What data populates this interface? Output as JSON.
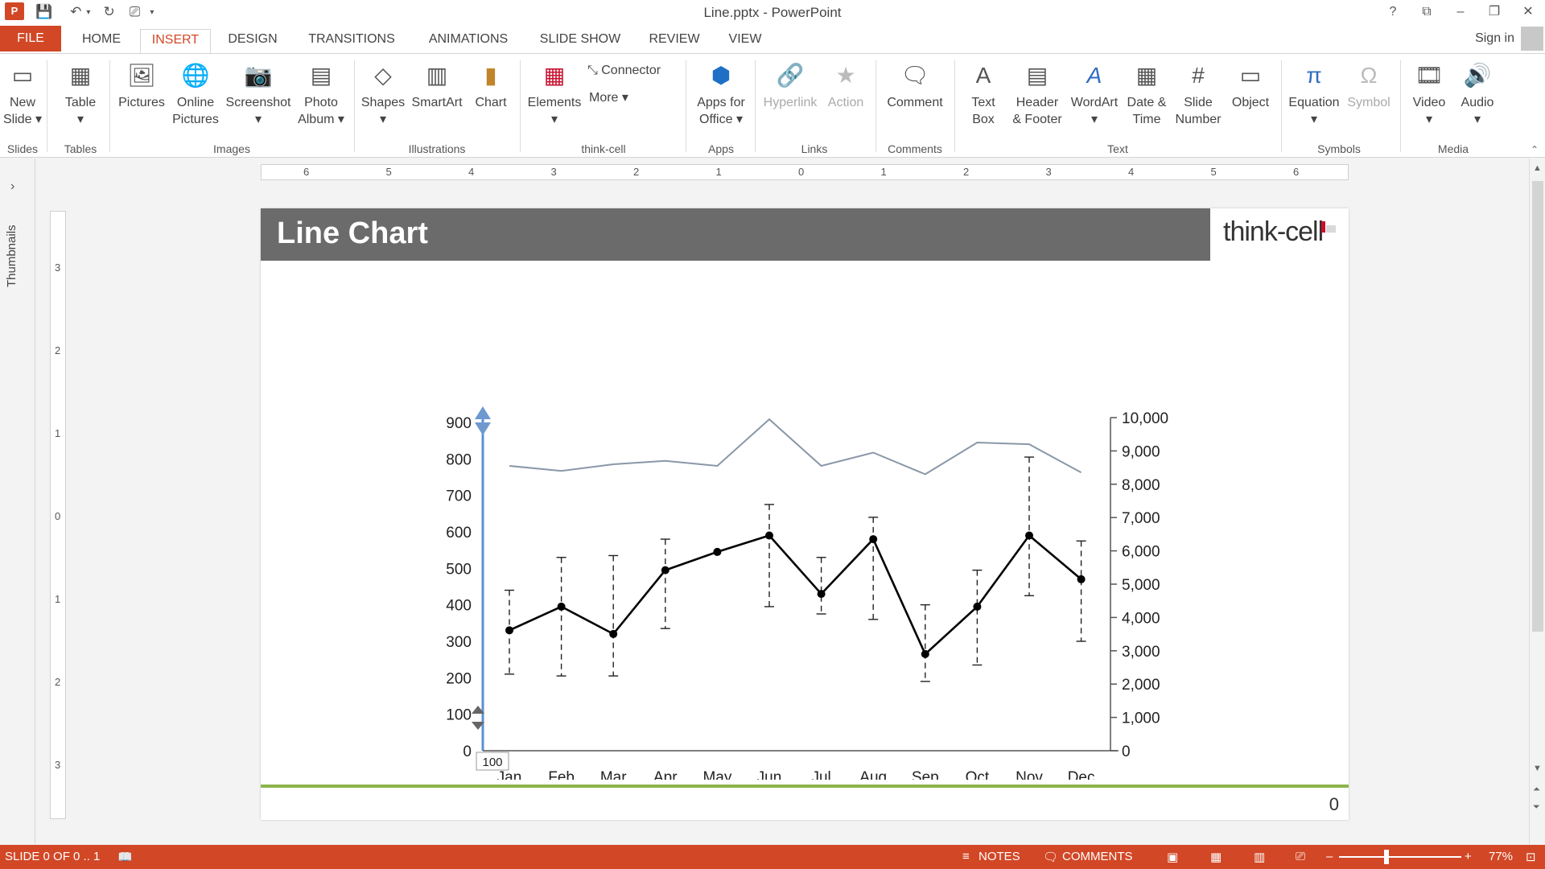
{
  "window": {
    "title": "Line.pptx - PowerPoint"
  },
  "qat": {
    "save_icon": "save-icon",
    "undo_icon": "undo-icon",
    "redo_icon": "redo-icon",
    "present_icon": "present-icon",
    "customize_icon": "customize-icon"
  },
  "tabs": {
    "file": "FILE",
    "home": "HOME",
    "insert": "INSERT",
    "design": "DESIGN",
    "transitions": "TRANSITIONS",
    "animations": "ANIMATIONS",
    "slideshow": "SLIDE SHOW",
    "review": "REVIEW",
    "view": "VIEW",
    "signin": "Sign in"
  },
  "ribbon": {
    "new_slide": [
      "New",
      "Slide ▾"
    ],
    "table": [
      "Table",
      "▾"
    ],
    "pictures": [
      "Pictures"
    ],
    "online_pictures": [
      "Online",
      "Pictures"
    ],
    "screenshot": [
      "Screenshot",
      "▾"
    ],
    "photo_album": [
      "Photo",
      "Album ▾"
    ],
    "shapes": [
      "Shapes",
      "▾"
    ],
    "smartart": [
      "SmartArt"
    ],
    "chart": [
      "Chart"
    ],
    "elements": [
      "Elements",
      "▾"
    ],
    "connector": "Connector",
    "more": "More ▾",
    "apps_office": [
      "Apps for",
      "Office ▾"
    ],
    "hyperlink": [
      "Hyperlink"
    ],
    "action": [
      "Action"
    ],
    "comment": [
      "Comment"
    ],
    "text_box": [
      "Text",
      "Box"
    ],
    "header_footer": [
      "Header",
      "& Footer"
    ],
    "wordart": [
      "WordArt",
      "▾"
    ],
    "date_time": [
      "Date &",
      "Time"
    ],
    "slide_number": [
      "Slide",
      "Number"
    ],
    "object": [
      "Object"
    ],
    "equation": [
      "Equation",
      "▾"
    ],
    "symbol": [
      "Symbol"
    ],
    "video": [
      "Video",
      "▾"
    ],
    "audio": [
      "Audio",
      "▾"
    ],
    "groups": {
      "slides": "Slides",
      "tables": "Tables",
      "images": "Images",
      "illustrations": "Illustrations",
      "thinkcell": "think-cell",
      "apps": "Apps",
      "links": "Links",
      "comments": "Comments",
      "text": "Text",
      "symbols": "Symbols",
      "media": "Media"
    }
  },
  "rail": {
    "thumbnails": "Thumbnails"
  },
  "rulers": {
    "horizontal": [
      "6",
      "5",
      "4",
      "3",
      "2",
      "1",
      "0",
      "1",
      "2",
      "3",
      "4",
      "5",
      "6"
    ],
    "vertical": [
      "3",
      "2",
      "1",
      "0",
      "1",
      "2",
      "3"
    ]
  },
  "slide": {
    "title": "Line Chart",
    "brand": "think-cell",
    "page_number": "0",
    "colors": {
      "header": "#6b6b6b",
      "footer_line": "#8db54b",
      "accent_red": "#c8102e"
    }
  },
  "chart_data": {
    "type": "line",
    "categories": [
      "Jan",
      "Feb",
      "Mar",
      "Apr",
      "May",
      "Jun",
      "Jul",
      "Aug",
      "Sep",
      "Oct",
      "Nov",
      "Dec"
    ],
    "y_left": {
      "ticks": [
        "0",
        "100",
        "200",
        "300",
        "400",
        "500",
        "600",
        "700",
        "800",
        "900"
      ],
      "range": [
        0,
        900
      ]
    },
    "y_right": {
      "ticks": [
        "0",
        "1,000",
        "2,000",
        "3,000",
        "4,000",
        "5,000",
        "6,000",
        "7,000",
        "8,000",
        "9,000",
        "10,000"
      ],
      "range": [
        0,
        10000
      ]
    },
    "series": [
      {
        "axis": "left",
        "color": "#000000",
        "markers": true,
        "values": [
          330,
          395,
          320,
          495,
          545,
          590,
          430,
          580,
          265,
          395,
          590,
          470
        ],
        "error_low": [
          210,
          205,
          205,
          335,
          null,
          395,
          375,
          360,
          190,
          235,
          425,
          300
        ],
        "error_high": [
          440,
          530,
          535,
          580,
          null,
          675,
          530,
          640,
          400,
          495,
          805,
          575
        ]
      },
      {
        "axis": "right",
        "color": "#8a97a8",
        "markers": false,
        "values": [
          8550,
          8400,
          8600,
          8700,
          8550,
          9950,
          8550,
          8950,
          8300,
          9250,
          9200,
          8350
        ]
      }
    ],
    "axis_handle_tooltip": "100",
    "grid": false,
    "legend": "none"
  },
  "status": {
    "slide": "SLIDE 0 OF 0 .. 1",
    "notes": "NOTES",
    "comments": "COMMENTS",
    "zoom": "77%",
    "bg_color": "#d24726"
  }
}
